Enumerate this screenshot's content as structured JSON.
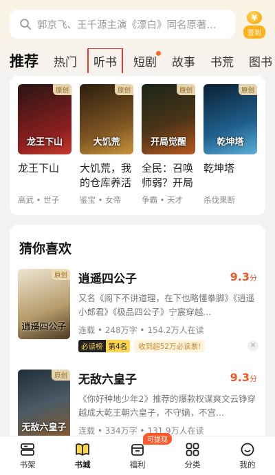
{
  "search": {
    "placeholder": "郭京飞、王千源主演《漂白》同名原著..."
  },
  "signin": {
    "coin": "¥",
    "label": "签到"
  },
  "tabs": [
    "推荐",
    "热门",
    "听书",
    "短剧",
    "故事",
    "书荒",
    "图书"
  ],
  "featured": [
    {
      "badge": "原创",
      "cover_text": "龙王下山",
      "title": "龙王下山",
      "tags": "高武 • 世子",
      "colors": [
        "#3a1a1a",
        "#8c1f1f"
      ]
    },
    {
      "badge": "原创",
      "cover_text": "大饥荒",
      "title": "大饥荒，我的仓库养活",
      "tags": "鉴宝 • 女帝",
      "colors": [
        "#3b2a12",
        "#a9762c"
      ]
    },
    {
      "badge": "原创",
      "cover_text": "开局觉醒",
      "title": "全民：召唤师弱？开局",
      "tags": "争霸 • 天才",
      "colors": [
        "#1d2a1a",
        "#7a3a1a"
      ]
    },
    {
      "badge": "原创",
      "cover_text": "乾坤塔",
      "title": "乾坤塔",
      "tags": "杀伐果断",
      "colors": [
        "#0f2a44",
        "#2b77a8"
      ]
    }
  ],
  "guess": {
    "title": "猜你喜欢",
    "items": [
      {
        "badge": "原创",
        "cover_text": "逍遥四公子",
        "title": "逍遥四公子",
        "score": "9.3",
        "score_unit": "分",
        "desc": "又名《阁下不讲道理，在下也略懂拳脚》《逍遥小郎君》《极品四公子》宁宸穿越...",
        "meta": "连载 • 248万字 • 154.2万人在读",
        "rank_label": "必读榜",
        "rank_pos": "第4名",
        "hint": "收到超52万必读票!",
        "colors": [
          "#e8dcc4",
          "#6b5a3a"
        ]
      },
      {
        "badge": "原创",
        "cover_text": "无敌六皇子",
        "title": "无敌六皇子",
        "score": "9.3",
        "score_unit": "分",
        "desc": "《你好种地少年2》推荐的爆款权谋爽文云铮穿越成大乾王朝六皇子，不守嫡，不宫...",
        "meta": "连载 • 334万字 • 131.9万人在读",
        "colors": [
          "#2a3a44",
          "#7a5a3a"
        ]
      }
    ]
  },
  "nav": {
    "items": [
      {
        "label": "书架",
        "icon": "bookshelf-icon"
      },
      {
        "label": "书城",
        "icon": "book-open-icon"
      },
      {
        "label": "福利",
        "icon": "welfare-icon",
        "badge": "可提现"
      },
      {
        "label": "分类",
        "icon": "category-icon"
      },
      {
        "label": "我的",
        "icon": "profile-icon"
      }
    ]
  },
  "colors": {
    "accent": "#ffd44d",
    "score": "#ec5b26"
  }
}
